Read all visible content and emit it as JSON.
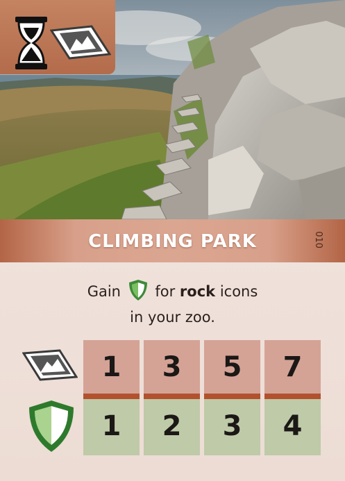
{
  "card": {
    "title": "CLIMBING PARK",
    "number": "010"
  },
  "effect": {
    "prefix": "Gain",
    "middle": "for",
    "keyword": "rock",
    "suffix": "icons",
    "line2": "in your zoo."
  },
  "icons": {
    "top_left": [
      "hourglass-icon",
      "rock-icon"
    ],
    "row_labels": [
      "rock-icon",
      "conservation-shield-icon"
    ]
  },
  "score_table": {
    "rock_counts": [
      "1",
      "3",
      "5",
      "7"
    ],
    "rewards": [
      "1",
      "2",
      "3",
      "4"
    ]
  },
  "colors": {
    "badge": "#b36c4b",
    "title_band": "#d8a08a",
    "rock_row": "#d4a396",
    "reward_row": "#bfcaa8",
    "separator": "#b3512f",
    "shield_green": "#3e8a3a"
  }
}
